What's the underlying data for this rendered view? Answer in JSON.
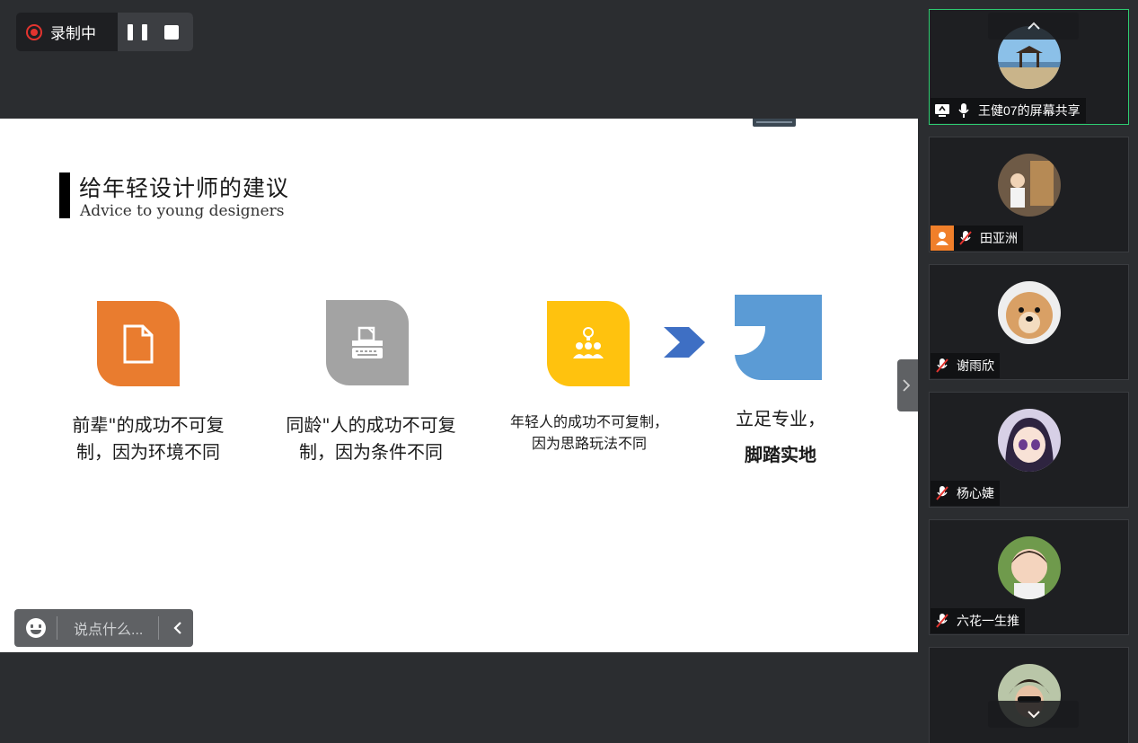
{
  "recording": {
    "status_label": "录制中",
    "pause_icon": "pause-icon",
    "stop_icon": "stop-icon",
    "accent": "#e3342f"
  },
  "slide": {
    "title_cn": "给年轻设计师的建议",
    "title_en": "Advice to young designers",
    "items": [
      {
        "icon": "document-icon",
        "color": "#e97c2f",
        "caption_lines": [
          "前辈\"的成功不可复",
          "制，因为环境不同"
        ]
      },
      {
        "icon": "typewriter-icon",
        "color": "#a3a3a3",
        "caption_lines": [
          "同龄\"人的成功不可复",
          "制，因为条件不同"
        ]
      },
      {
        "icon": "team-idea-icon",
        "color": "#ffc20e",
        "caption_lines": [
          "年轻人的成功不可复制，",
          "因为思路玩法不同"
        ]
      },
      {
        "icon": "speech-shape-icon",
        "color": "#5b9bd5",
        "caption_lines": [
          "立足专业，",
          "脚踏实地"
        ]
      }
    ],
    "arrow_color": "#3e6fc4"
  },
  "chat": {
    "placeholder": "说点什么...",
    "emoji_icon": "emoji-icon",
    "collapse_icon": "chevron-left-icon"
  },
  "participants": [
    {
      "name": "王健07的屏幕共享",
      "active": true,
      "icons": [
        "screen-share-icon",
        "mic-icon"
      ]
    },
    {
      "name": "田亚洲",
      "active": false,
      "icons": [
        "host-icon",
        "mic-muted-icon"
      ]
    },
    {
      "name": "谢雨欣",
      "active": false,
      "icons": [
        "mic-muted-icon"
      ]
    },
    {
      "name": "杨心婕",
      "active": false,
      "icons": [
        "mic-muted-icon"
      ]
    },
    {
      "name": "六花一生推",
      "active": false,
      "icons": [
        "mic-muted-icon"
      ]
    },
    {
      "name": "",
      "active": false,
      "icons": []
    }
  ],
  "colors": {
    "background": "#2b2d30",
    "panel_card": "#1e1f22",
    "active_border": "#2ecc71"
  }
}
